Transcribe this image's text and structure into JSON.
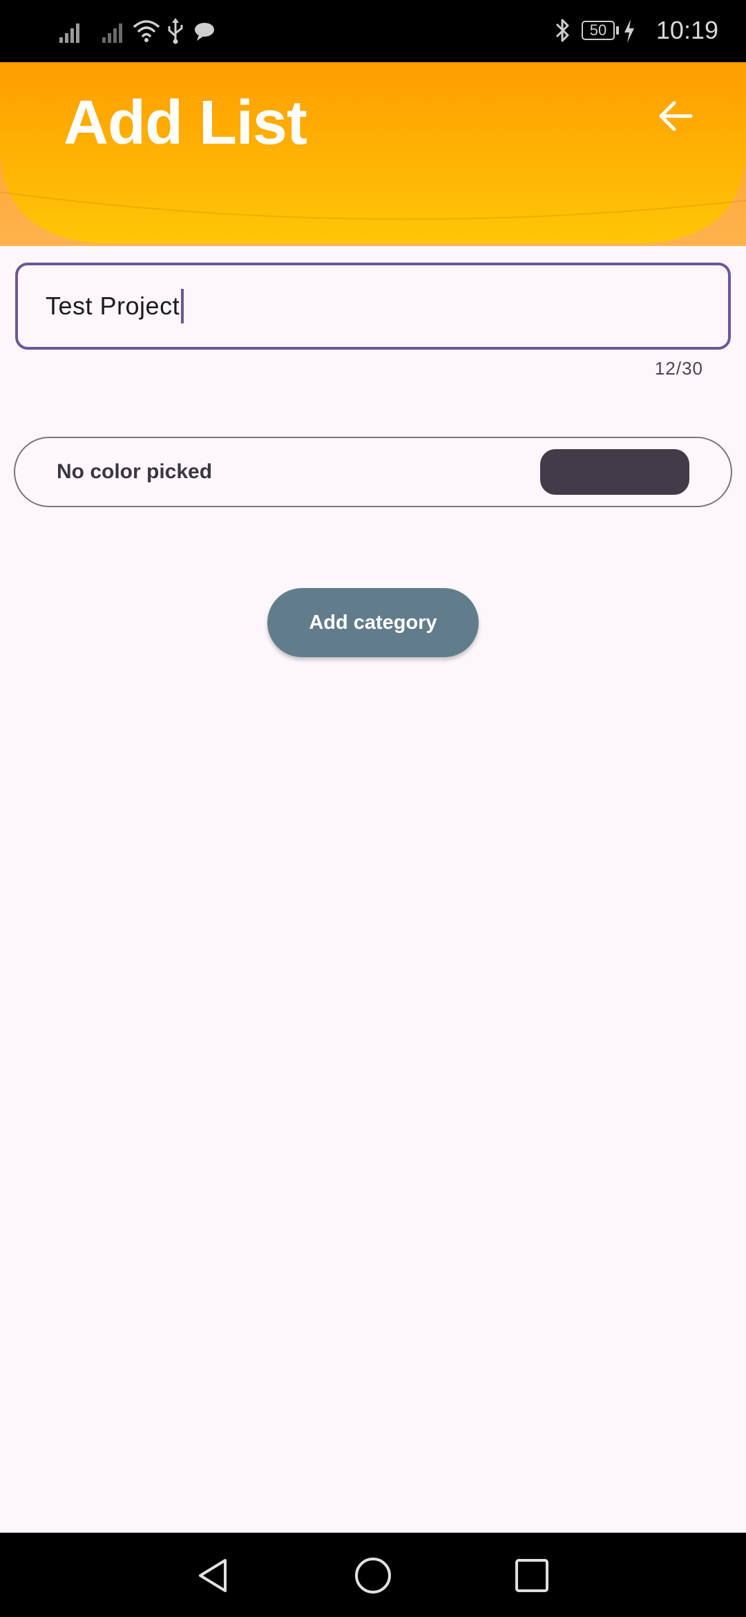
{
  "status_bar": {
    "time": "10:19",
    "battery_level": "50",
    "icons": [
      "signal-icon",
      "signal-icon",
      "wifi-icon",
      "usb-icon",
      "message-icon",
      "bluetooth-icon",
      "battery-icon",
      "charging-icon"
    ]
  },
  "header": {
    "title": "Add List",
    "back_icon": "arrow-left-icon",
    "gradient_colors": [
      "#ff9d00",
      "#ffc107"
    ]
  },
  "name_field": {
    "value": "Test Project",
    "counter": "12/30",
    "border_color": "#6a5994"
  },
  "color_picker": {
    "label": "No color picked",
    "swatch_color": "#433a4a"
  },
  "actions": {
    "add_category_label": "Add category",
    "button_color": "#617d8b"
  },
  "nav_bar": {
    "icons": [
      "back-triangle-icon",
      "home-circle-icon",
      "recents-square-icon"
    ]
  }
}
